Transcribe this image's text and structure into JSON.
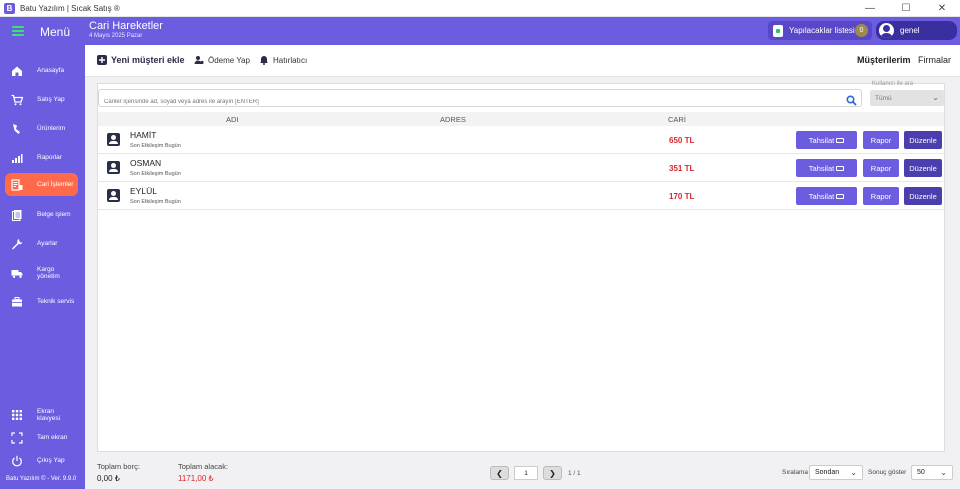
{
  "window": {
    "title": "Batu Yazılım | Sıcak Satış ®",
    "app_icon_letter": "B",
    "minimize": "—",
    "maximize": "☐",
    "close": "✕"
  },
  "header": {
    "menu_label": "Menü",
    "page_title": "Cari Hareketler",
    "page_date": "4 Mayıs 2025 Pazar",
    "todo_label": "Yapılacaklar listesi",
    "todo_count": "0",
    "user_name": "genel"
  },
  "sidebar": {
    "items": [
      {
        "label": "Anasayfa",
        "icon": "home-icon"
      },
      {
        "label": "Satış Yap",
        "icon": "cart-icon"
      },
      {
        "label": "Ürünlerim",
        "icon": "product-icon"
      },
      {
        "label": "Raporlar",
        "icon": "chart-icon"
      },
      {
        "label": "Cari İşlemler",
        "icon": "accounts-icon",
        "active": true
      },
      {
        "label": "Belge işlem",
        "icon": "document-icon"
      },
      {
        "label": "Ayarlar",
        "icon": "wrench-icon"
      },
      {
        "label": "Kargo yönetim",
        "icon": "truck-icon"
      },
      {
        "label": "Teknik servis",
        "icon": "briefcase-icon"
      }
    ],
    "bottom_items": [
      {
        "label": "Ekran klavyesi",
        "icon": "keyboard-grid-icon"
      },
      {
        "label": "Tam ekran",
        "icon": "fullscreen-icon"
      },
      {
        "label": "Çıkış Yap",
        "icon": "power-icon"
      }
    ],
    "version": "Batu Yazılım © - Ver. 9.9.0"
  },
  "toolbar": {
    "new_customer": "Yeni müşteri ekle",
    "payment": "Ödeme Yap",
    "reminder": "Hatırlatıcı",
    "tab_customers": "Müşterilerim",
    "tab_companies": "Firmalar"
  },
  "search": {
    "placeholder": "Cariler içerisinde ad, soyad veya adres ile arayın [ENTER]",
    "filter_label": "Kullanıcı ile ara",
    "filter_value": "Tümü"
  },
  "table": {
    "headers": {
      "name": "ADI",
      "address": "ADRES",
      "balance": "CARİ"
    },
    "rows": [
      {
        "name": "HAMİT",
        "sub": "Son Etkileşim Bugün",
        "amount": "650 TL"
      },
      {
        "name": "OSMAN",
        "sub": "Son Etkileşim Bugün",
        "amount": "351 TL"
      },
      {
        "name": "EYLÜL",
        "sub": "Son Etkileşim Bugün",
        "amount": "170 TL"
      }
    ],
    "btn_collect": "Tahsilat",
    "btn_report": "Rapor",
    "btn_edit": "Düzenle"
  },
  "footer": {
    "total_debt_label": "Toplam borç:",
    "total_debt_value": "0,00 ₺",
    "total_receivable_label": "Toplam alacak:",
    "total_receivable_value": "1171,00 ₺",
    "page_current": "1",
    "page_info": "1 / 1",
    "sort_label": "Sıralama",
    "sort_value": "Sondan",
    "count_label": "Sonuç göster",
    "count_value": "50"
  },
  "colors": {
    "primary": "#6c5ce0",
    "active_nav": "#ff6b4a",
    "amount": "#d9262b"
  }
}
